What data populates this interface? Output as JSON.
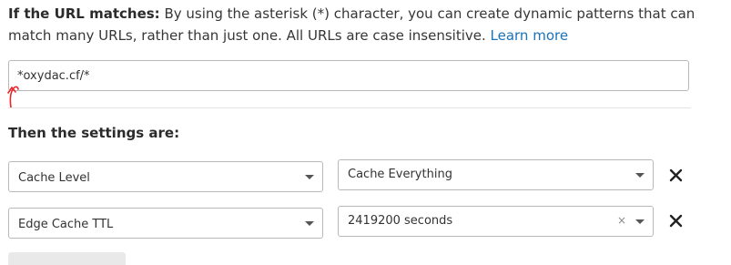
{
  "url_rule": {
    "label": "If the URL matches:",
    "description": " By using the asterisk (*) character, you can create dynamic patterns that can match many URLs, rather than just one. All URLs are case insensitive. ",
    "learn_more": "Learn more",
    "value": "*oxydac.cf/*"
  },
  "settings": {
    "heading": "Then the settings are:",
    "rows": [
      {
        "setting": "Cache Level",
        "value": "Cache Everything"
      },
      {
        "setting": "Edge Cache TTL",
        "value": "2419200 seconds",
        "clear": "×"
      }
    ]
  },
  "annotation_color": "#e8262b",
  "link_color": "#1a73b8"
}
